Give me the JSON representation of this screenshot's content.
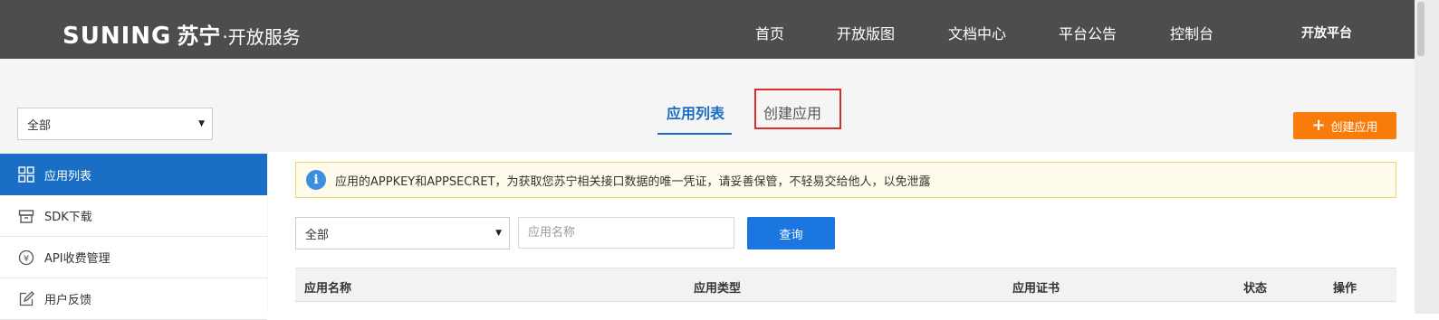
{
  "header": {
    "brand": "SUNING",
    "brand_cn": "苏宁",
    "subtitle": "·开放服务",
    "nav": [
      "首页",
      "开放版图",
      "文档中心",
      "平台公告",
      "控制台"
    ],
    "platform": "开放平台"
  },
  "sidebar": {
    "filter_value": "全部",
    "items": [
      {
        "label": "应用列表",
        "icon": "grid-icon",
        "active": true
      },
      {
        "label": "SDK下载",
        "icon": "package-icon",
        "active": false
      },
      {
        "label": "API收费管理",
        "icon": "yen-icon",
        "active": false
      },
      {
        "label": "用户反馈",
        "icon": "edit-icon",
        "active": false
      }
    ]
  },
  "tabs": [
    {
      "label": "应用列表",
      "active": true
    },
    {
      "label": "创建应用",
      "active": false
    }
  ],
  "create_button": "创建应用",
  "notice": {
    "icon": "info-icon",
    "text": "应用的APPKEY和APPSECRET，为获取您苏宁相关接口数据的唯一凭证，请妥善保管，不轻易交给他人，以免泄露"
  },
  "filters": {
    "type_value": "全部",
    "name_placeholder": "应用名称",
    "query_label": "查询"
  },
  "table": {
    "headers": [
      "应用名称",
      "应用类型",
      "应用证书",
      "状态",
      "操作"
    ]
  },
  "colors": {
    "header_bg": "#4d4d4d",
    "accent_blue": "#1b6ec6",
    "orange": "#f97c0a",
    "highlight_red": "#d92d2d"
  }
}
